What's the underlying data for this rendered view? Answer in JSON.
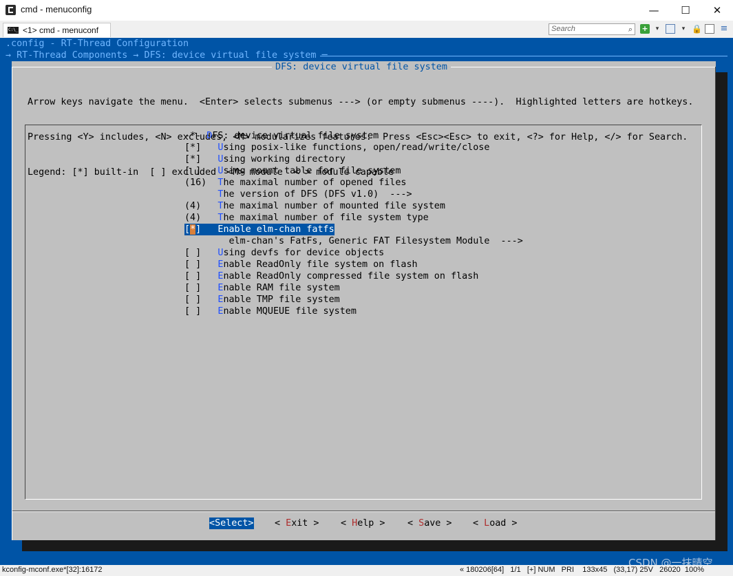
{
  "window": {
    "title": "cmd - menuconfig",
    "minimize_glyph": "—",
    "maximize_glyph": "☐",
    "close_glyph": "✕"
  },
  "tabs": [
    {
      "label": "<1> cmd - menuconf",
      "icon": "console-icon",
      "icon_text": "C:\\_"
    }
  ],
  "toolbar": {
    "search_placeholder": "Search",
    "search_icon": "⌕",
    "plus_icon": "+",
    "dropdown_glyph": "▾",
    "lock_icon": "🔒",
    "menu_icon": "≡"
  },
  "console": {
    "header_line1": ".config - RT-Thread Configuration",
    "header_line2": "→ RT-Thread Components → DFS: device virtual file system ─"
  },
  "dialog": {
    "title": "DFS: device virtual file system",
    "help_lines": [
      "Arrow keys navigate the menu.  <Enter> selects submenus ---> (or empty submenus ----).  Highlighted letters are hotkeys.",
      "Pressing <Y> includes, <N> excludes, <M> modularizes features.  Press <Esc><Esc> to exit, <?> for Help, </> for Search.",
      "Legend: [*] built-in  [ ] excluded  <M> module  < > module capable"
    ],
    "menu_items": [
      {
        "prefix": "-*- ",
        "hot": "D",
        "rest": "FS: device virtual file system",
        "selected": false
      },
      {
        "prefix": "[*]   ",
        "hot": "U",
        "rest": "sing posix-like functions, open/read/write/close",
        "selected": false
      },
      {
        "prefix": "[*]   ",
        "hot": "U",
        "rest": "sing working directory",
        "selected": false
      },
      {
        "prefix": "[ ]   ",
        "hot": "U",
        "rest": "sing mount table for file system",
        "selected": false
      },
      {
        "prefix": "(16)  ",
        "hot": "T",
        "rest": "he maximal number of opened files",
        "selected": false
      },
      {
        "prefix": "      ",
        "hot": "T",
        "rest": "he version of DFS (DFS v1.0)  --->",
        "selected": false
      },
      {
        "prefix": "(4)   ",
        "hot": "T",
        "rest": "he maximal number of mounted file system",
        "selected": false
      },
      {
        "prefix": "(4)   ",
        "hot": "T",
        "rest": "he maximal number of file system type",
        "selected": false
      },
      {
        "prefix": "[*]   ",
        "hot": "E",
        "rest": "nable elm-chan fatfs",
        "selected": true
      },
      {
        "prefix": "        ",
        "hot": "",
        "rest": "elm-chan's FatFs, Generic FAT Filesystem Module  --->",
        "selected": false
      },
      {
        "prefix": "[ ]   ",
        "hot": "U",
        "rest": "sing devfs for device objects",
        "selected": false
      },
      {
        "prefix": "[ ]   ",
        "hot": "E",
        "rest": "nable ReadOnly file system on flash",
        "selected": false
      },
      {
        "prefix": "[ ]   ",
        "hot": "E",
        "rest": "nable ReadOnly compressed file system on flash",
        "selected": false
      },
      {
        "prefix": "[ ]   ",
        "hot": "E",
        "rest": "nable RAM file system",
        "selected": false
      },
      {
        "prefix": "[ ]   ",
        "hot": "E",
        "rest": "nable TMP file system",
        "selected": false
      },
      {
        "prefix": "[ ]   ",
        "hot": "E",
        "rest": "nable MQUEUE file system",
        "selected": false
      }
    ],
    "buttons": [
      {
        "pre": "<",
        "hot": "S",
        "rest": "elect>",
        "selected": true
      },
      {
        "pre": "< ",
        "hot": "E",
        "rest": "xit >",
        "selected": false
      },
      {
        "pre": "< ",
        "hot": "H",
        "rest": "elp >",
        "selected": false
      },
      {
        "pre": "< ",
        "hot": "S",
        "rest": "ave >",
        "selected": false
      },
      {
        "pre": "< ",
        "hot": "L",
        "rest": "oad >",
        "selected": false
      }
    ]
  },
  "watermark": "CSDN @一抹晴空",
  "statusbar": {
    "left": "kconfig-mconf.exe*[32]:16172",
    "right": "« 180206[64]   1/1   [+] NUM   PRI    133x45   (33,17) 25V   26020  100%"
  }
}
